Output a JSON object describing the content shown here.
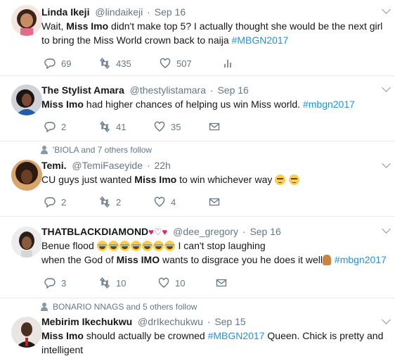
{
  "tweets": [
    {
      "name": "Linda Ikeji",
      "handle": "@lindaikeji",
      "time": "Sep 16",
      "text_segments": [
        {
          "t": "Wait, ",
          "b": false
        },
        {
          "t": "Miss Imo",
          "b": true
        },
        {
          "t": " didn't make top 5? I actually thought she would be the next girl to bring the Miss World crown back to naija ",
          "b": false
        },
        {
          "t": "#MBGN2017",
          "tag": true
        }
      ],
      "replies": "69",
      "retweets": "435",
      "likes": "507",
      "fourth_icon": "analytics-icon"
    },
    {
      "name": "The Stylist Amara",
      "handle": "@thestylistamara",
      "time": "Sep 16",
      "replies": "2",
      "retweets": "41",
      "likes": "35",
      "fourth_icon": "dm-envelope-icon"
    },
    {
      "social_context": "'BIOLA and 7 others follow",
      "name": "Temi.",
      "handle": "@TemiFaseyide",
      "time": "22h",
      "replies": "2",
      "retweets": "2",
      "likes": "4",
      "fourth_icon": "dm-envelope-icon"
    },
    {
      "name": "THATBLACKDIAMOND",
      "name_hearts": "♥♡♥",
      "handle": "@dee_gregory",
      "time": "Sep 16",
      "line1": "Benue flood ",
      "line1b": " I can't stop laughing",
      "line2a": "when the God of ",
      "line2b": "Miss IMO",
      "line2c": " wants to disgrace you he does it well",
      "tag": "#mbgn2017",
      "replies": "3",
      "retweets": "10",
      "likes": "10",
      "fourth_icon": "dm-envelope-icon"
    },
    {
      "social_context": "BONARIO NNAGS and 5 others follow",
      "name": "Mebirim Ikechukwu",
      "handle": "@drIkechukwu",
      "time": "Sep 15",
      "bold": "Miss Imo",
      "text_a": " should actually be crowned ",
      "tag": "#MBGN2017",
      "text_b": " Queen. Chick is pretty and intelligent"
    }
  ],
  "t2_text": {
    "bold": "Miss Imo",
    "rest": " had higher chances of helping us win Miss world. ",
    "tag": "#mbgn2017"
  },
  "t3_text": {
    "pre": "CU guys just wanted ",
    "bold": "Miss Imo",
    "post": " to win whichever way "
  }
}
